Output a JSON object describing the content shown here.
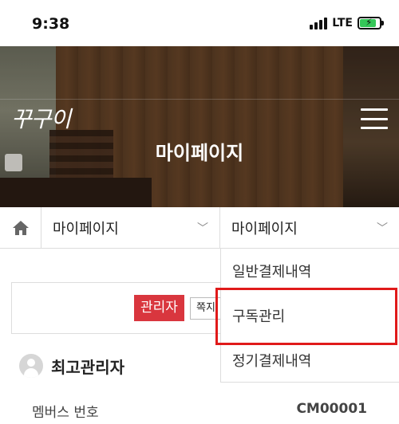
{
  "status": {
    "time": "9:38",
    "network": "LTE",
    "battery_level": 0.85,
    "battery_color": "#35c759"
  },
  "hero": {
    "logo": "꾸구이",
    "title": "마이페이지",
    "menu_icon": "hamburger-icon"
  },
  "breadcrumb": {
    "home_icon": "home-icon",
    "first_select": "마이페이지",
    "second_select": "마이페이지"
  },
  "dropdown": {
    "items": [
      {
        "label": "일반결제내역"
      },
      {
        "label": "구독관리",
        "highlighted": true
      },
      {
        "label": "정기결제내역"
      }
    ]
  },
  "admin": {
    "badge": "관리자",
    "message_button": "쪽지"
  },
  "profile": {
    "name": "최고관리자"
  },
  "member": {
    "label": "멤버스 번호",
    "value": "CM00001"
  },
  "colors": {
    "badge": "#d9363e",
    "highlight": "#e01a1a"
  }
}
